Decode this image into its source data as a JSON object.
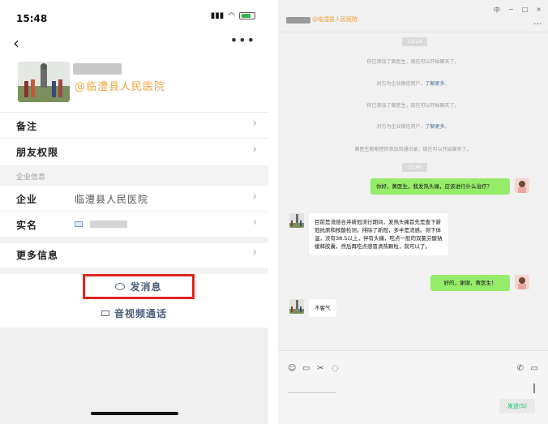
{
  "phone": {
    "status_time": "15:48",
    "company": "@临澧县人民医院",
    "rows": {
      "remark": "备注",
      "friend_perm": "朋友权限",
      "section_enterprise": "企业信息",
      "enterprise_label": "企业",
      "enterprise_value": "临澧县人民医院",
      "realname_label": "实名",
      "more_info": "更多信息"
    },
    "send_message": "发消息",
    "av_call": "音视频通话"
  },
  "pc": {
    "title": "@临澧县人民医院",
    "time1": "12:24",
    "time2": "15:40",
    "notes": {
      "added1": "你已添加了黄医生，现在可以开始聊天了。",
      "ent_prefix": "对方为企业微信用户，",
      "ent_link": "了解更多",
      "ent_suffix": "。",
      "added2": "你已添加了黄医生，现在可以开始聊天了。",
      "mutual": "黄医生刚刚把你添加到通讯录，现在可以开始聊天了。"
    },
    "messages": {
      "q1": "你好，黄医生，我发热头痛，应该进行什么治疗？",
      "a1": "目前是流感合并新冠流行期间，发热头痛首先是查下新冠抗原和核酸检测，排除了新冠，多半是流感。测下体温，没有38.5以上，伴有头痛，吃点一般的双氯芬酸钠缓释胶囊，然后再吃点感冒清热颗粒，就可以了。",
      "q2": "好的，谢谢，黄医生！",
      "a2": "不客气"
    },
    "send_label": "发送(S)",
    "window_controls": [
      "中",
      "−",
      "□",
      "×"
    ]
  }
}
